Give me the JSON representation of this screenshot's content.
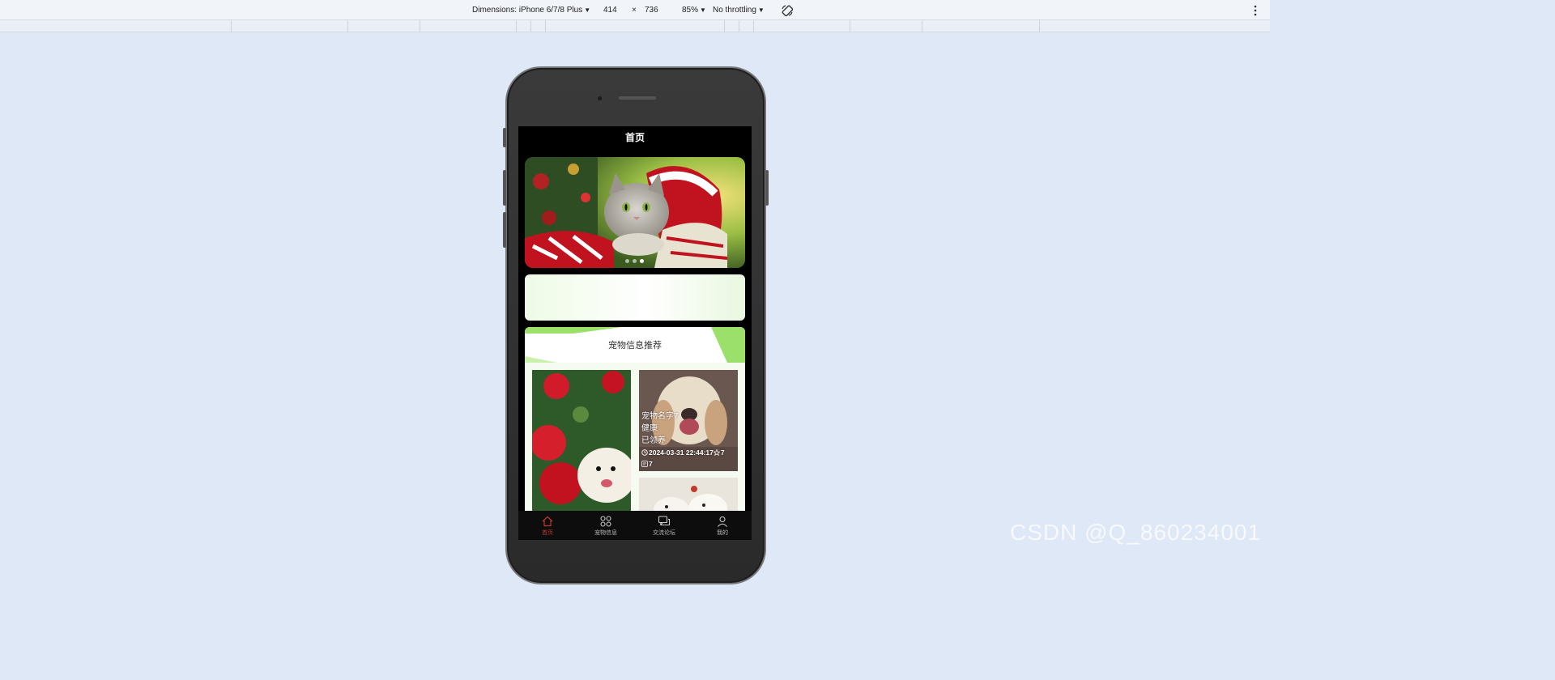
{
  "devtools": {
    "dimensions_label": "Dimensions: iPhone 6/7/8 Plus",
    "width": "414",
    "times": "×",
    "height": "736",
    "zoom": "85%",
    "throttling": "No throttling"
  },
  "app": {
    "header_title": "首页",
    "banner": {
      "dots": 3,
      "active_dot": 2
    },
    "recommend_title": "宠物信息推荐",
    "cards": [
      {
        "name": "宠物名字7",
        "health": "健康",
        "status": "已领养",
        "time": "2024-03-31 22:44:17",
        "favorites": "7",
        "comments": "7"
      }
    ],
    "tabs": [
      {
        "label": "首页",
        "icon": "home-icon",
        "active": true
      },
      {
        "label": "宠物信息",
        "icon": "grid-icon",
        "active": false
      },
      {
        "label": "交流论坛",
        "icon": "chat-icon",
        "active": false
      },
      {
        "label": "我的",
        "icon": "user-icon",
        "active": false
      }
    ]
  },
  "watermark": "CSDN @Q_860234001",
  "colors": {
    "active_tab": "#c0392b",
    "accent_green": "#8bdc5c"
  }
}
